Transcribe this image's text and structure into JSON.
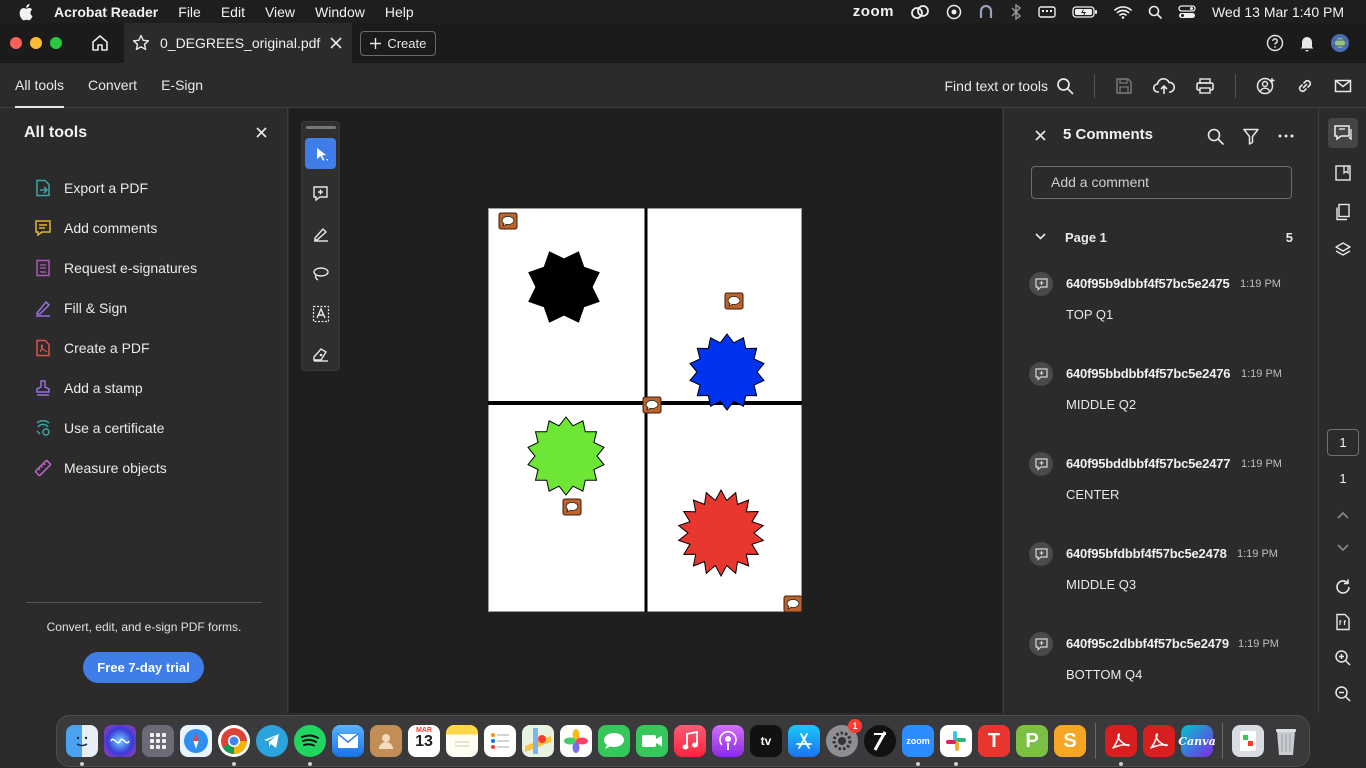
{
  "menubar": {
    "app_name": "Acrobat Reader",
    "menus": [
      "File",
      "Edit",
      "View",
      "Window",
      "Help"
    ],
    "zoom_label": "zoom",
    "clock": "Wed 13 Mar  1:40 PM"
  },
  "tabbar": {
    "doc_title": "0_DEGREES_original.pdf",
    "create_label": "Create"
  },
  "toolbar": {
    "tabs": [
      "All tools",
      "Convert",
      "E-Sign"
    ],
    "find_label": "Find text or tools"
  },
  "left_panel": {
    "title": "All tools",
    "items": [
      {
        "label": "Export a PDF",
        "icon": "export-pdf-icon"
      },
      {
        "label": "Add comments",
        "icon": "comment-icon"
      },
      {
        "label": "Request e-signatures",
        "icon": "request-signature-icon"
      },
      {
        "label": "Fill & Sign",
        "icon": "fill-sign-icon"
      },
      {
        "label": "Create a PDF",
        "icon": "create-pdf-icon"
      },
      {
        "label": "Add a stamp",
        "icon": "stamp-icon"
      },
      {
        "label": "Use a certificate",
        "icon": "certificate-icon"
      },
      {
        "label": "Measure objects",
        "icon": "ruler-icon"
      }
    ],
    "promo_text": "Convert, edit, and e-sign PDF forms.",
    "trial_button": "Free 7-day trial"
  },
  "comments": {
    "title": "5 Comments",
    "add_placeholder": "Add a comment",
    "page_label": "Page 1",
    "page_count": "5",
    "items": [
      {
        "author": "640f95b9dbbf4f57bc5e2475",
        "time": "1:19 PM",
        "text": "TOP Q1"
      },
      {
        "author": "640f95bbdbbf4f57bc5e2476",
        "time": "1:19 PM",
        "text": "MIDDLE Q2"
      },
      {
        "author": "640f95bddbbf4f57bc5e2477",
        "time": "1:19 PM",
        "text": "CENTER"
      },
      {
        "author": "640f95bfdbbf4f57bc5e2478",
        "time": "1:19 PM",
        "text": "MIDDLE Q3"
      },
      {
        "author": "640f95c2dbbf4f57bc5e2479",
        "time": "1:19 PM",
        "text": "BOTTOM Q4"
      }
    ]
  },
  "right_rail": {
    "current_page": "1",
    "total_pages": "1"
  },
  "document": {
    "star_colors": {
      "q1": "#000000",
      "q2": "#0033ee",
      "q3": "#6ee636",
      "q4": "#e8372f"
    },
    "note_color": "#c0622b"
  },
  "dock": {
    "calendar_month": "MAR",
    "calendar_day": "13",
    "settings_badge": "1",
    "canva_label": "Canva"
  },
  "colors": {
    "accent": "#3f7ee8"
  }
}
